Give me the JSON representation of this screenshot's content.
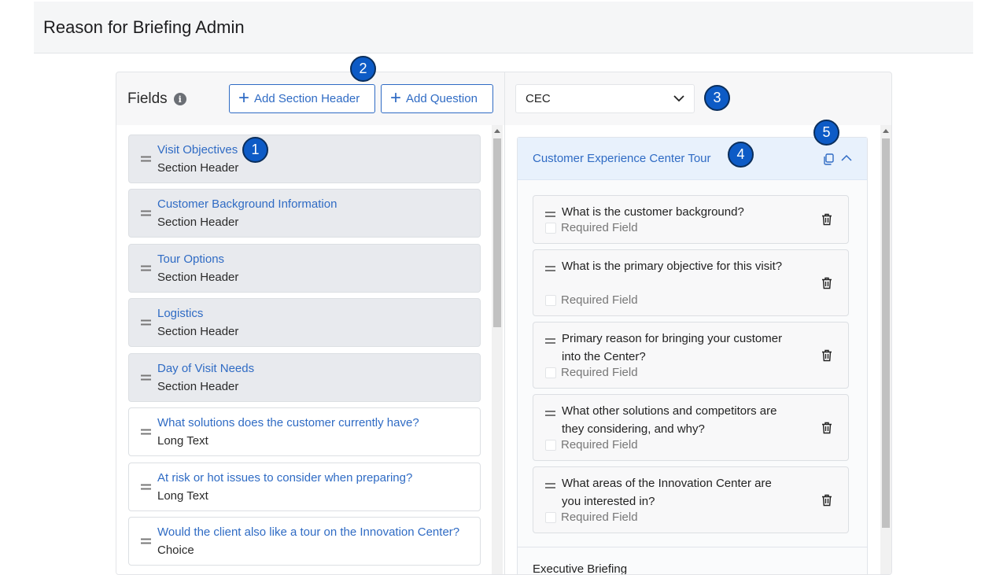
{
  "header": {
    "title": "Reason for Briefing Admin"
  },
  "fields_panel": {
    "title": "Fields",
    "add_section_header_label": "Add Section Header",
    "add_question_label": "Add Question",
    "items": [
      {
        "name": "Visit Objectives",
        "type": "Section Header"
      },
      {
        "name": "Customer Background Information",
        "type": "Section Header"
      },
      {
        "name": "Tour Options",
        "type": "Section Header"
      },
      {
        "name": "Logistics",
        "type": "Section Header"
      },
      {
        "name": "Day of Visit Needs",
        "type": "Section Header"
      },
      {
        "name": "What solutions does the customer currently have?",
        "type": "Long Text"
      },
      {
        "name": "At risk or hot issues to consider when preparing?",
        "type": "Long Text"
      },
      {
        "name": "Would the client also like a tour on the Innovation Center?",
        "type": "Choice"
      }
    ]
  },
  "form_panel": {
    "center_select": {
      "value": "CEC"
    },
    "section": {
      "title": "Customer Experience Center Tour",
      "questions": [
        {
          "text": "What is the customer background?",
          "required_label": "Required Field"
        },
        {
          "text": "What is the primary objective for this visit?",
          "required_label": "Required Field"
        },
        {
          "text": "Primary reason for bringing your customer into the Center?",
          "required_label": "Required Field"
        },
        {
          "text": "What other solutions and competitors are they considering, and why?",
          "required_label": "Required Field"
        },
        {
          "text": "What areas of the Innovation Center are you interested in?",
          "required_label": "Required Field"
        }
      ]
    },
    "next_section_title": "Executive Briefing"
  },
  "callouts": [
    "1",
    "2",
    "3",
    "4",
    "5"
  ],
  "colors": {
    "accent": "#2f6bc4",
    "callout": "#0d5bc6"
  }
}
